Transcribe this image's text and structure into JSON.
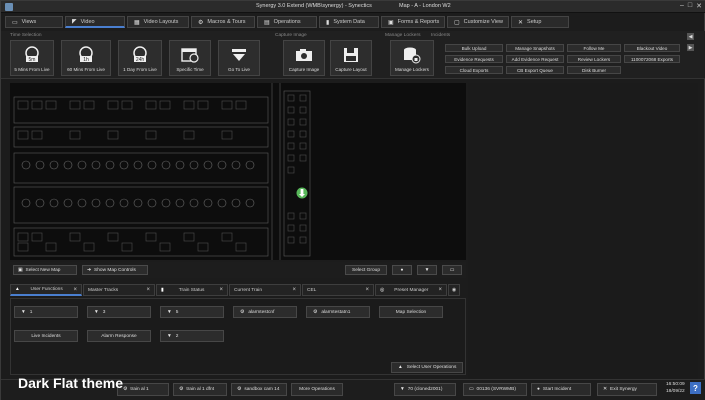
{
  "window": {
    "title": "Synergy 3.0 Extend (WMB\\synergy) - Synectics",
    "map_title": "Map - A - London W2"
  },
  "tabs": [
    {
      "label": "Views",
      "icon": "monitor-icon"
    },
    {
      "label": "Video",
      "icon": "camera-icon"
    },
    {
      "label": "Video Layouts",
      "icon": "layout-icon"
    },
    {
      "label": "Macros & Tours",
      "icon": "macros-icon"
    },
    {
      "label": "Operations",
      "icon": "operations-icon"
    },
    {
      "label": "System Data",
      "icon": "bar-chart-icon"
    },
    {
      "label": "Forms & Reports",
      "icon": "forms-icon"
    },
    {
      "label": "Customize View",
      "icon": "window-icon"
    },
    {
      "label": "Setup",
      "icon": "tools-icon"
    }
  ],
  "ribbon": {
    "time_selection": {
      "label": "Time Selection",
      "buttons": [
        {
          "label": "5 Mins From Live",
          "badge": "5m"
        },
        {
          "label": "60 Mins From Live",
          "badge": "1h"
        },
        {
          "label": "1 Day From Live",
          "badge": "24h"
        },
        {
          "label": "Specific Time",
          "badge": ""
        },
        {
          "label": "Go To Live",
          "badge": ""
        }
      ]
    },
    "capture_image": {
      "label": "Capture Image",
      "buttons": [
        {
          "label": "Capture Image"
        },
        {
          "label": "Capture Layout"
        }
      ]
    },
    "manage_lockers": {
      "label": "Manage Lockers",
      "buttons": [
        {
          "label": "Manage Lockers"
        }
      ]
    },
    "incidents": {
      "label": "Incidents",
      "buttons": [
        "Bulk Upload",
        "Manage Snapshots",
        "Follow Me",
        "Blackout Video",
        "Evidence Requests",
        "Add Evidence Request",
        "Review Lockers",
        "1100072068 Exports",
        "Cloud Exports",
        "CB Export Queue",
        "Disk Burner"
      ]
    }
  },
  "map_toolbar": {
    "select_new_map": "Select New Map",
    "show_map_controls": "Show Map Controls",
    "select_group": "Select Group"
  },
  "function_tabs": [
    {
      "label": "User Functions",
      "active": true
    },
    {
      "label": "Master Tracks",
      "active": false
    },
    {
      "label": "Train Status",
      "active": false
    },
    {
      "label": "Current Train",
      "active": false
    },
    {
      "label": "CEL",
      "active": false
    },
    {
      "label": "Preset Manager",
      "active": false
    }
  ],
  "function_buttons": {
    "row1": [
      "1",
      "3",
      "5",
      "alarmtestcnf",
      "alarmtestatn1",
      "Map Selection"
    ],
    "row2": [
      "Live Incidents",
      "Alarm Response",
      "2"
    ],
    "select_user_operations": "Select User Operations"
  },
  "status_bar": {
    "theme_label": "Dark Flat theme",
    "buttons": [
      "train al 1",
      "train al 1 dfnt",
      "sandbox cam 14",
      "More Operations",
      "70 (cloned2001)",
      "00136 (SVRWMB)",
      "Start Incident",
      "Exit Synergy"
    ],
    "time": "16:50:09",
    "date": "18/09/22",
    "help": "?"
  }
}
